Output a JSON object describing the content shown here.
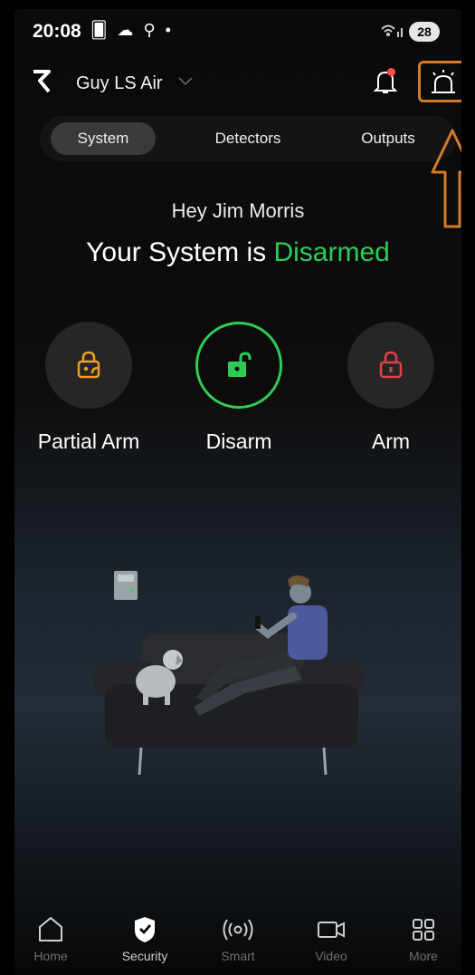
{
  "status_bar": {
    "time": "20:08",
    "indicators": "🂠 ☁ ⚲ •",
    "battery": "28"
  },
  "header": {
    "site_name": "Guy LS Air",
    "logo_glyph": "Ɂ",
    "notification_dot_color": "#ff4d4d",
    "highlight_color": "#d27a2c"
  },
  "tabs": [
    {
      "label": "System",
      "active": true
    },
    {
      "label": "Detectors",
      "active": false
    },
    {
      "label": "Outputs",
      "active": false
    }
  ],
  "greeting": "Hey Jim Morris",
  "headline": {
    "prefix": "Your System is ",
    "state": "Disarmed",
    "state_color": "#2ecc55"
  },
  "modes": [
    {
      "label": "Partial Arm",
      "icon": "partial-lock-icon",
      "color": "#f0a020"
    },
    {
      "label": "Disarm",
      "icon": "unlock-icon",
      "color": "#2ecc55",
      "active": true
    },
    {
      "label": "Arm",
      "icon": "lock-icon",
      "color": "#e04048"
    }
  ],
  "bottom_nav": [
    {
      "label": "Home",
      "icon": "home-icon"
    },
    {
      "label": "Security",
      "icon": "shield-icon",
      "active": true
    },
    {
      "label": "Smart",
      "icon": "broadcast-icon"
    },
    {
      "label": "Video",
      "icon": "video-camera-icon"
    },
    {
      "label": "More",
      "icon": "grid-icon"
    }
  ]
}
